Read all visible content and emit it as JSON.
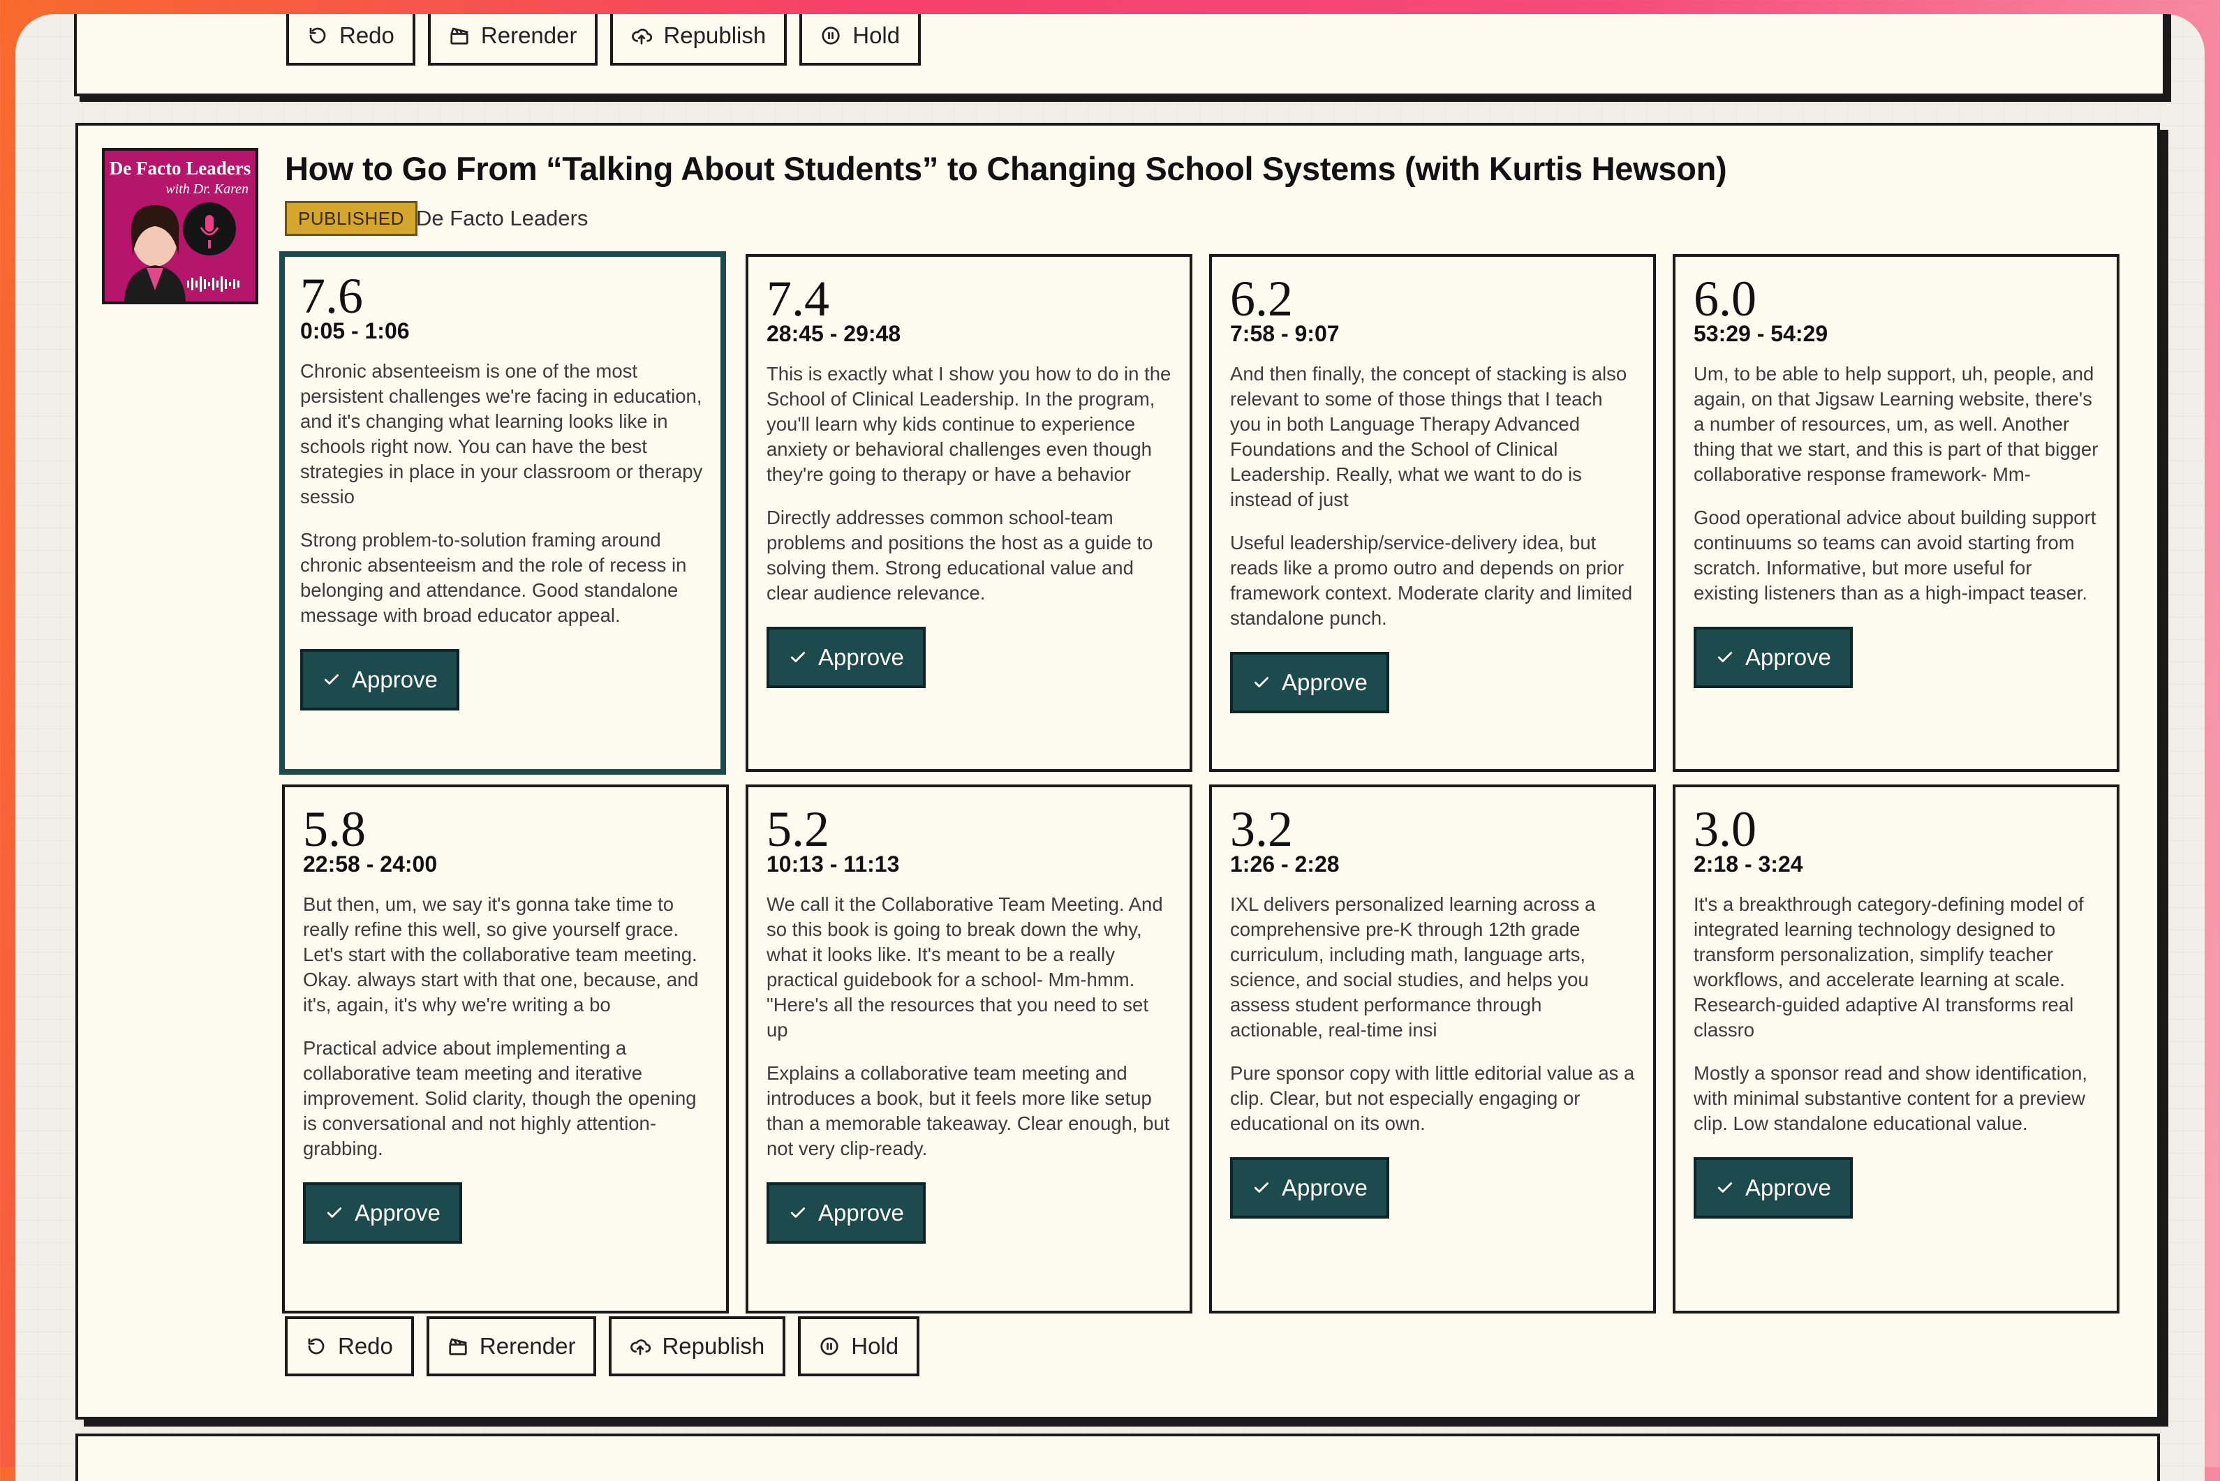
{
  "episode": {
    "title": "How to Go From “Talking About Students” to Changing School Systems (with Kurtis Hewson)",
    "status": "PUBLISHED",
    "show": "De Facto Leaders",
    "cover": {
      "title": "De Facto Leaders",
      "subtitle": "with Dr. Karen"
    }
  },
  "actions": {
    "redo": "Redo",
    "rerender": "Rerender",
    "republish": "Republish",
    "hold": "Hold"
  },
  "approve_label": "Approve",
  "clips": [
    {
      "score": "7.6",
      "range": "0:05 - 1:06",
      "transcript": "Chronic absenteeism is one of the most persistent challenges we're facing in education, and it's changing what learning looks like in schools right now. You can have the best strategies in place in your classroom or therapy sessio",
      "critique": "Strong problem-to-solution framing around chronic absenteeism and the role of recess in belonging and attendance. Good standalone message with broad educator appeal."
    },
    {
      "score": "7.4",
      "range": "28:45 - 29:48",
      "transcript": "This is exactly what I show you how to do in the School of Clinical Leadership. In the program, you'll learn why kids continue to experience anxiety or behavioral challenges even though they're going to therapy or have a behavior",
      "critique": "Directly addresses common school-team problems and positions the host as a guide to solving them. Strong educational value and clear audience relevance."
    },
    {
      "score": "6.2",
      "range": "7:58 - 9:07",
      "transcript": "And then finally, the concept of stacking is also relevant to some of those things that I teach you in both Language Therapy Advanced Foundations and the School of Clinical Leadership. Really, what we want to do is instead of just",
      "critique": "Useful leadership/service-delivery idea, but reads like a promo outro and depends on prior framework context. Moderate clarity and limited standalone punch."
    },
    {
      "score": "6.0",
      "range": "53:29 - 54:29",
      "transcript": "Um, to be able to help support, uh, people, and again, on that Jigsaw Learning website, there's a number of resources, um, as well. Another thing that we start, and this is part of that bigger collaborative response framework- Mm-",
      "critique": "Good operational advice about building support continuums so teams can avoid starting from scratch. Informative, but more useful for existing listeners than as a high-impact teaser."
    },
    {
      "score": "5.8",
      "range": "22:58 - 24:00",
      "transcript": "But then, um, we say it's gonna take time to really refine this well, so give yourself grace. Let's start with the collaborative team meeting. Okay. always start with that one, because, and it's, again, it's why we're writing a bo",
      "critique": "Practical advice about implementing a collaborative team meeting and iterative improvement. Solid clarity, though the opening is conversational and not highly attention-grabbing."
    },
    {
      "score": "5.2",
      "range": "10:13 - 11:13",
      "transcript": "We call it the Collaborative Team Meeting. And so this book is going to break down the why, what it looks like. It's meant to be a really practical guidebook for a school- Mm-hmm. \"Here's all the resources that you need to set up",
      "critique": "Explains a collaborative team meeting and introduces a book, but it feels more like setup than a memorable takeaway. Clear enough, but not very clip-ready."
    },
    {
      "score": "3.2",
      "range": "1:26 - 2:28",
      "transcript": "IXL delivers personalized learning across a comprehensive pre-K through 12th grade curriculum, including math, language arts, science, and social studies, and helps you assess student performance through actionable, real-time insi",
      "critique": "Pure sponsor copy with little editorial value as a clip. Clear, but not especially engaging or educational on its own."
    },
    {
      "score": "3.0",
      "range": "2:18 - 3:24",
      "transcript": "It's a breakthrough category-defining model of integrated learning technology designed to transform personalization, simplify teacher workflows, and accelerate learning at scale. Research-guided adaptive AI transforms real classro",
      "critique": "Mostly a sponsor read and show identification, with minimal substantive content for a preview clip. Low standalone educational value."
    }
  ]
}
